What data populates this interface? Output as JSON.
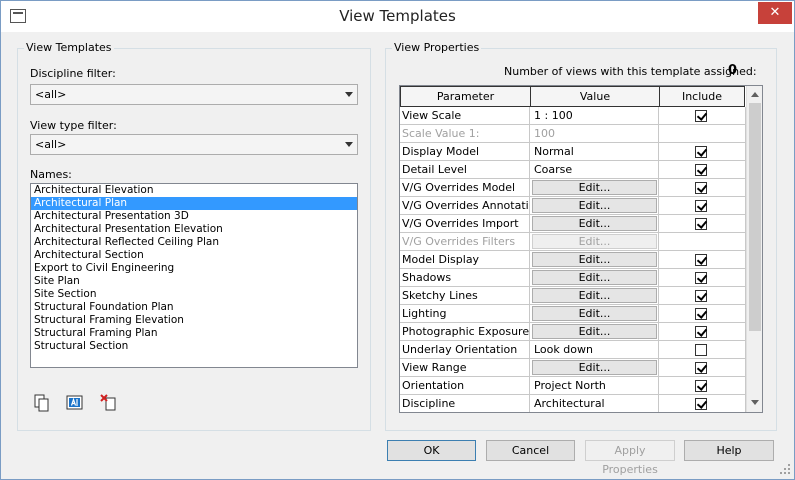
{
  "window": {
    "title": "View Templates",
    "close_glyph": "✕"
  },
  "left": {
    "group_title": "View Templates",
    "discipline_filter_label": "Discipline filter:",
    "discipline_filter_value": "<all>",
    "view_type_filter_label": "View type filter:",
    "view_type_filter_value": "<all>",
    "names_label": "Names:",
    "names": [
      "Architectural Elevation",
      "Architectural Plan",
      "Architectural Presentation 3D",
      "Architectural Presentation Elevation",
      "Architectural Reflected Ceiling Plan",
      "Architectural Section",
      "Export to Civil Engineering",
      "Site Plan",
      "Site Section",
      "Structural Foundation Plan",
      "Structural Framing Elevation",
      "Structural Framing Plan",
      "Structural Section"
    ],
    "selected_index": 1,
    "tools": [
      "duplicate-icon",
      "rename-icon",
      "delete-icon"
    ]
  },
  "right": {
    "group_title": "View Properties",
    "count_label": "Number of views with this template assigned:",
    "count_value": "0",
    "columns": {
      "parameter": "Parameter",
      "value": "Value",
      "include": "Include"
    },
    "rows": [
      {
        "parameter": "View Scale",
        "value": "1 : 100",
        "type": "text",
        "include": true,
        "disabled": false
      },
      {
        "parameter": "Scale Value    1:",
        "value": "100",
        "type": "text",
        "include": null,
        "disabled": true
      },
      {
        "parameter": "Display Model",
        "value": "Normal",
        "type": "text",
        "include": true,
        "disabled": false
      },
      {
        "parameter": "Detail Level",
        "value": "Coarse",
        "type": "text",
        "include": true,
        "disabled": false
      },
      {
        "parameter": "V/G Overrides Model",
        "value": "Edit...",
        "type": "button",
        "include": true,
        "disabled": false
      },
      {
        "parameter": "V/G Overrides Annotati",
        "value": "Edit...",
        "type": "button",
        "include": true,
        "disabled": false
      },
      {
        "parameter": "V/G Overrides Import",
        "value": "Edit...",
        "type": "button",
        "include": true,
        "disabled": false
      },
      {
        "parameter": "V/G Overrides Filters",
        "value": "Edit...",
        "type": "button",
        "include": null,
        "disabled": true
      },
      {
        "parameter": "Model Display",
        "value": "Edit...",
        "type": "button",
        "include": true,
        "disabled": false
      },
      {
        "parameter": "Shadows",
        "value": "Edit...",
        "type": "button",
        "include": true,
        "disabled": false
      },
      {
        "parameter": "Sketchy Lines",
        "value": "Edit...",
        "type": "button",
        "include": true,
        "disabled": false
      },
      {
        "parameter": "Lighting",
        "value": "Edit...",
        "type": "button",
        "include": true,
        "disabled": false
      },
      {
        "parameter": "Photographic Exposure",
        "value": "Edit...",
        "type": "button",
        "include": true,
        "disabled": false
      },
      {
        "parameter": "Underlay Orientation",
        "value": "Look down",
        "type": "text",
        "include": false,
        "disabled": false
      },
      {
        "parameter": "View Range",
        "value": "Edit...",
        "type": "button",
        "include": true,
        "disabled": false
      },
      {
        "parameter": "Orientation",
        "value": "Project North",
        "type": "text",
        "include": true,
        "disabled": false
      },
      {
        "parameter": "Discipline",
        "value": "Architectural",
        "type": "text",
        "include": true,
        "disabled": false
      }
    ]
  },
  "buttons": {
    "ok": "OK",
    "cancel": "Cancel",
    "apply": "Apply Properties",
    "help": "Help"
  }
}
